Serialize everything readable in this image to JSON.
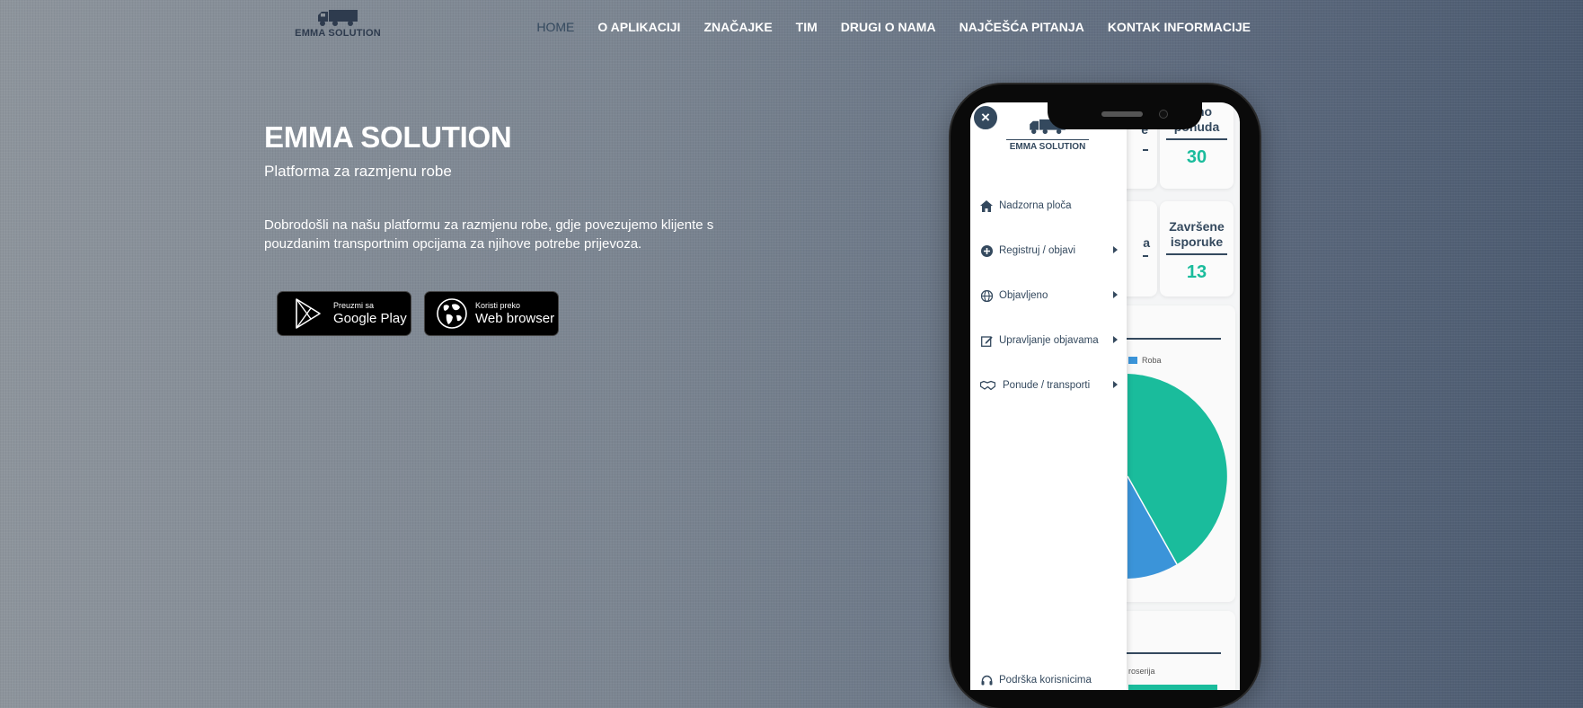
{
  "brand": {
    "name": "EMMA SOLUTION"
  },
  "nav": {
    "items": [
      {
        "label": "HOME",
        "active": true
      },
      {
        "label": "O APLIKACIJI"
      },
      {
        "label": "ZNAČAJKE"
      },
      {
        "label": "TIM"
      },
      {
        "label": "DRUGI O NAMA"
      },
      {
        "label": "NAJČEŠĆA PITANJA"
      },
      {
        "label": "KONTAK INFORMACIJE"
      }
    ]
  },
  "hero": {
    "title": "EMMA SOLUTION",
    "subtitle": "Platforma za razmjenu robe",
    "description": "Dobrodošli na našu platformu za razmjenu robe, gdje povezujemo klijente s pouzdanim transportnim opcijama za njihove potrebe prijevoza."
  },
  "buttons": {
    "google_play": {
      "small": "Preuzmi sa",
      "big": "Google Play",
      "icon": "google-play-icon"
    },
    "web": {
      "small": "Koristi preko",
      "big": "Web browser",
      "icon": "globe-icon"
    }
  },
  "phone": {
    "drawer": {
      "logo_text": "EMMA SOLUTION",
      "close_label": "×",
      "items": [
        {
          "label": "Nadzorna ploča",
          "icon": "home-icon"
        },
        {
          "label": "Registruj / objavi",
          "icon": "plus-circle-icon"
        },
        {
          "label": "Objavljeno",
          "icon": "globe-icon"
        },
        {
          "label": "Upravljanje objavama",
          "icon": "edit-icon"
        },
        {
          "label": "Ponude / transporti",
          "icon": "handshake-icon"
        }
      ],
      "support": {
        "label": "Podrška korisnicima",
        "icon": "headset-icon"
      }
    },
    "dashboard": {
      "card1": {
        "label": "upno ponuda",
        "value": "30"
      },
      "card2": {
        "label": "Završene isporuke",
        "value": "13"
      },
      "card_partial_1": "e",
      "card_partial_2": "a",
      "legend_label": "Roba",
      "bottom_label": "roserija",
      "colors": {
        "teal": "#1abc9c",
        "blue": "#3b94d9",
        "navy": "#34495e"
      }
    }
  }
}
